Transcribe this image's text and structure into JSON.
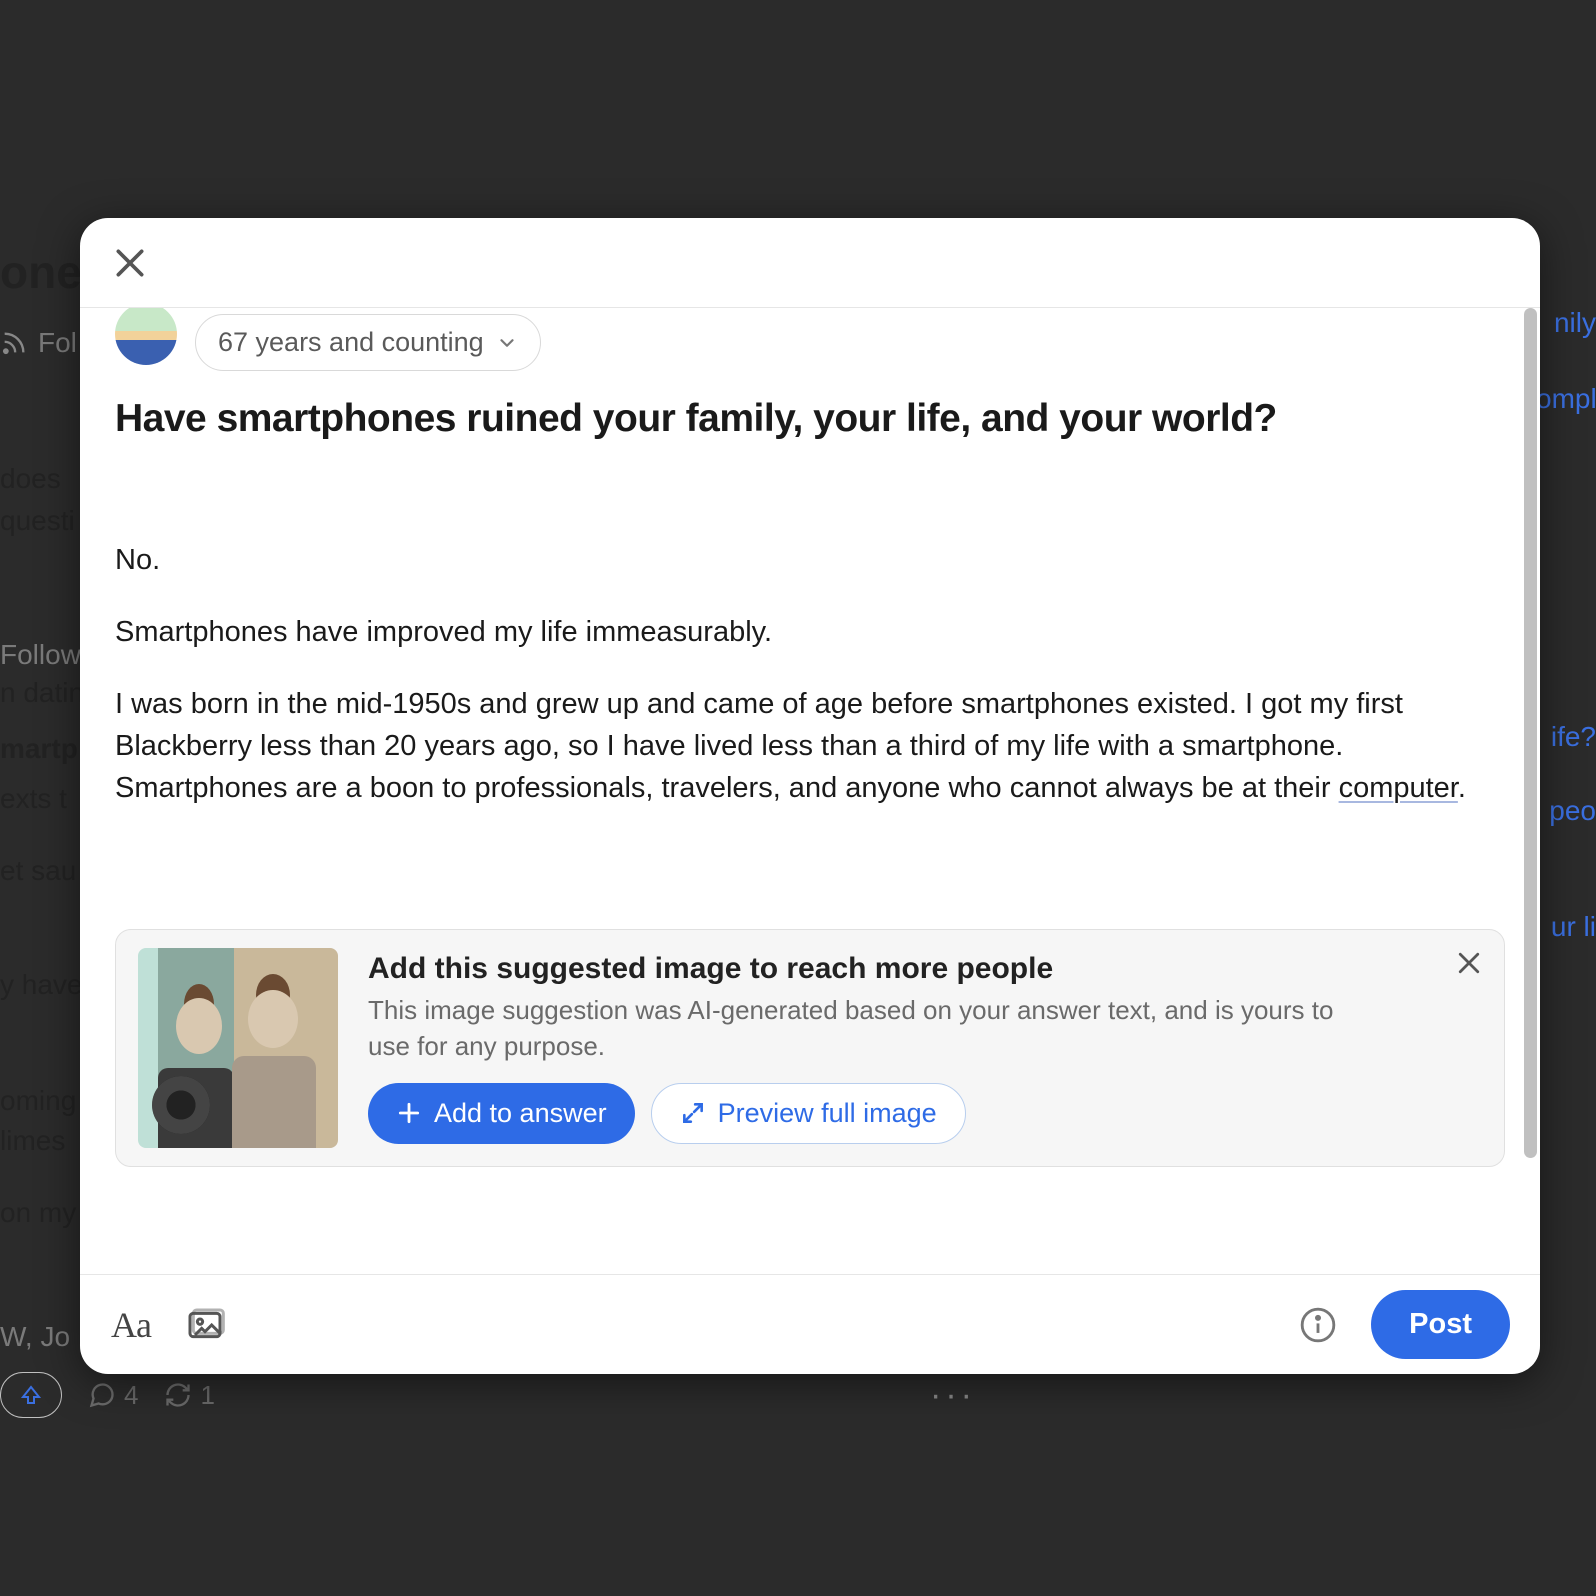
{
  "bg": {
    "title_fragment": "ones",
    "follow": "Fol",
    "q1a": "does",
    "q1b": "questi",
    "q2a": "Follow",
    "q2b": "n datin",
    "q3a": "martp",
    "q3b": "exts t",
    "q4": "et sau",
    "q5": "y have",
    "q6a": "oming",
    "q6b": " limes",
    "q7": "on my",
    "author": " W, Jo",
    "r1": "nily",
    "r2": "ompl",
    "r3": "ife?",
    "r4": "peo",
    "r5": "ur li",
    "comments": "4",
    "reshares": "1",
    "more": "···"
  },
  "credential": "67 years and counting",
  "question": "Have smartphones ruined your family, your life, and your world?",
  "answer": {
    "p1": "No.",
    "p2": "Smartphones have improved my life immeasurably.",
    "p3_a": "I was born in the mid-1950s and grew up and came of age before smartphones existed. I got my first Blackberry less than 20 years ago, so I have lived less than a third of my life with a smartphone. Smartphones are a boon to professionals, travelers, and anyone who cannot always be at their ",
    "p3_link": "computer",
    "p3_b": "."
  },
  "suggestion": {
    "title": "Add this suggested image to reach more people",
    "subtitle": "This image suggestion was AI-generated based on your answer text, and is yours to use for any purpose.",
    "add_label": "Add to answer",
    "preview_label": "Preview full image"
  },
  "footer": {
    "text_tool": "Aa",
    "post_label": "Post"
  }
}
